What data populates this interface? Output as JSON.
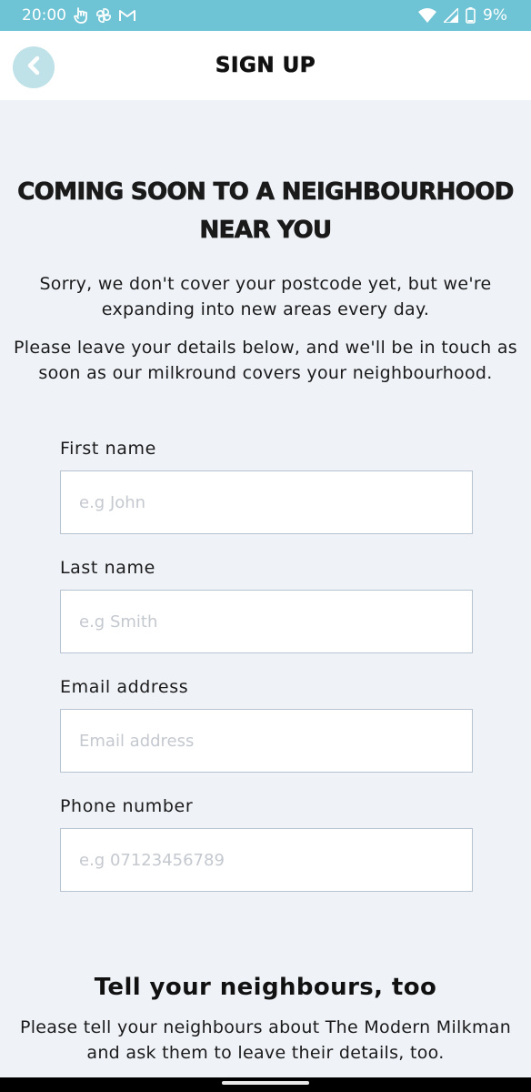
{
  "status_bar": {
    "time": "20:00",
    "battery": "9%",
    "icons": [
      "hand-icon",
      "pinwheel-icon",
      "gmail-icon",
      "wifi-icon",
      "signal-icon",
      "battery-icon"
    ]
  },
  "header": {
    "title": "SIGN UP",
    "back_icon": "chevron-left-icon"
  },
  "hero": {
    "title": "COMING SOON TO A NEIGHBOURHOOD NEAR YOU",
    "paragraph_1": "Sorry, we don't cover your postcode yet, but we're expanding into new areas every day.",
    "paragraph_2": "Please leave your details below, and we'll be in touch as soon as our milkround covers your neighbourhood."
  },
  "form": {
    "first_name": {
      "label": "First name",
      "placeholder": "e.g John",
      "value": ""
    },
    "last_name": {
      "label": "Last name",
      "placeholder": "e.g Smith",
      "value": ""
    },
    "email": {
      "label": "Email address",
      "placeholder": "Email address",
      "value": ""
    },
    "phone": {
      "label": "Phone number",
      "placeholder": "e.g 07123456789",
      "value": ""
    }
  },
  "neighbours": {
    "title": "Tell your neighbours, too",
    "text": "Please tell your neighbours about The Modern Milkman and ask them to leave their details, too."
  },
  "colors": {
    "status_bar": "#6ec3d4",
    "back_button": "#bfe1e8",
    "background": "#eff3f8",
    "input_border": "#b8c3d2"
  }
}
